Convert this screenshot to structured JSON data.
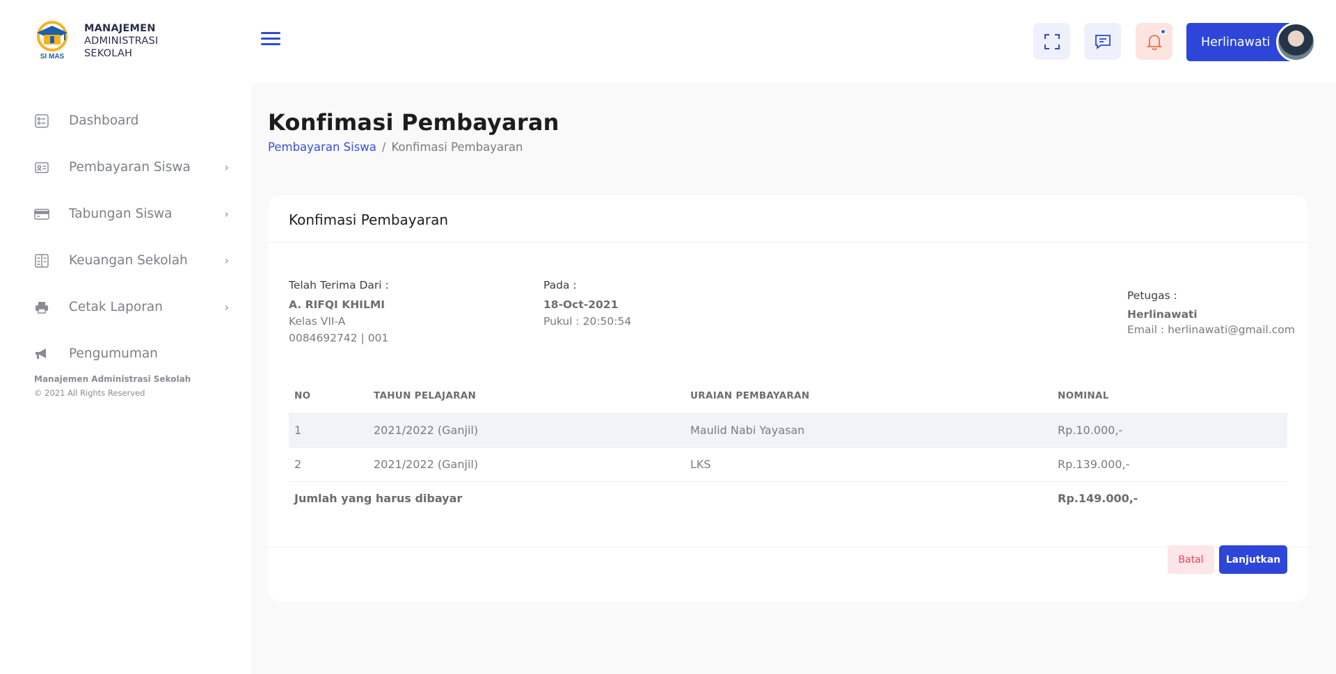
{
  "app": {
    "logo_text_line1": "MANAJEMEN",
    "logo_text_line2": "ADMINISTRASI",
    "logo_text_line3": "SEKOLAH",
    "logo_badge": "SI MAS"
  },
  "sidebar": {
    "items": [
      {
        "label": "Dashboard",
        "icon": "dashboard-icon"
      },
      {
        "label": "Pembayaran Siswa",
        "icon": "id-card-icon"
      },
      {
        "label": "Tabungan Siswa",
        "icon": "credit-card-icon"
      },
      {
        "label": "Keuangan Sekolah",
        "icon": "ledger-icon"
      },
      {
        "label": "Cetak Laporan",
        "icon": "printer-icon"
      },
      {
        "label": "Pengumuman",
        "icon": "megaphone-icon"
      }
    ],
    "footer_title": "Manajemen Administrasi Sekolah",
    "footer_copy": "© 2021 All Rights Reserved"
  },
  "header": {
    "user_name": "Herlinawati"
  },
  "page": {
    "title": "Konfimasi Pembayaran",
    "breadcrumb_parent": "Pembayaran Siswa",
    "breadcrumb_sep": "/",
    "breadcrumb_current": "Konfimasi Pembayaran"
  },
  "card": {
    "title": "Konfimasi Pembayaran",
    "received_label": "Telah Terima Dari :",
    "student_name": "A. RIFQI KHILMI",
    "student_class": "Kelas VII-A",
    "student_ids": "0084692742 | 001",
    "date_label": "Pada :",
    "date_value": "18-Oct-2021",
    "time_value": "Pukul : 20:50:54",
    "officer_label": "Petugas :",
    "officer_name": "Herlinawati",
    "officer_email": "Email : herlinawati@gmail.com",
    "table": {
      "headers": [
        "NO",
        "TAHUN PELAJARAN",
        "URAIAN PEMBAYARAN",
        "NOMINAL"
      ],
      "rows": [
        [
          "1",
          "2021/2022 (Ganjil)",
          "Maulid Nabi Yayasan",
          "Rp.10.000,-"
        ],
        [
          "2",
          "2021/2022 (Ganjil)",
          "LKS",
          "Rp.139.000,-"
        ]
      ],
      "total_label": "Jumlah yang harus dibayar",
      "total_value": "Rp.149.000,-"
    },
    "cancel_label": "Batal",
    "next_label": "Lanjutkan"
  },
  "colors": {
    "primary": "#2d45d8",
    "danger_bg": "#fde5e8",
    "danger_text": "#e0455b"
  }
}
